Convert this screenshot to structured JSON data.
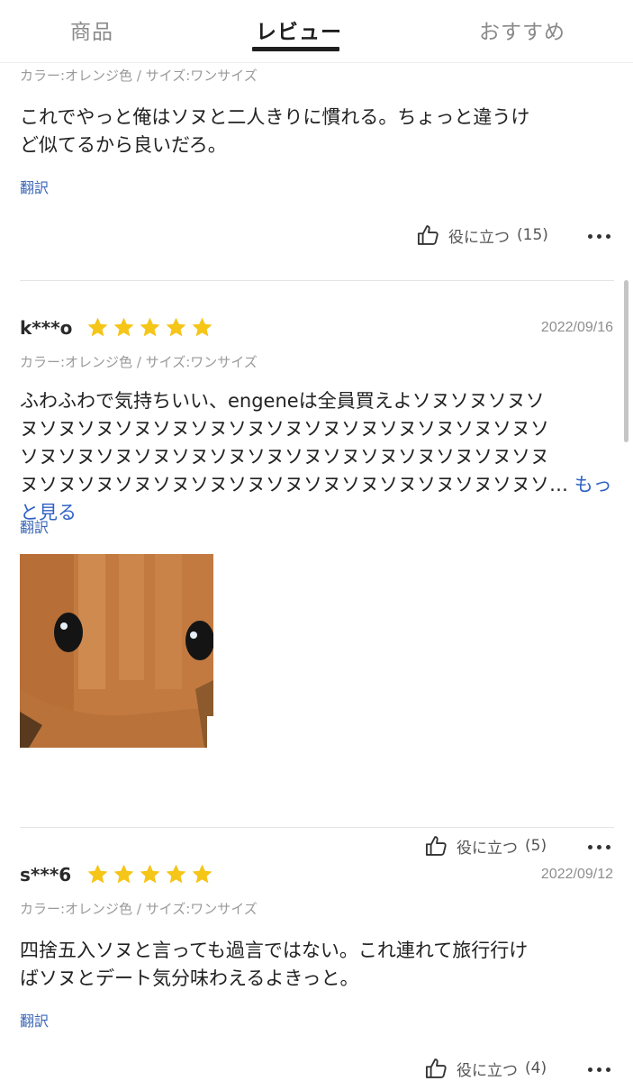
{
  "tabs": [
    {
      "label": "商品"
    },
    {
      "label": "レビュー"
    },
    {
      "label": "おすすめ"
    }
  ],
  "reviews": [
    {
      "variant": "カラー:オレンジ色 / サイズ:ワンサイズ",
      "text_lines": [
        "これでやっと俺はソヌと二人きりに慣れる。ちょっと違うけ",
        "ど似てるから良いだろ。"
      ],
      "translate": "翻訳",
      "helpful_label": "役に立つ",
      "helpful_count": "(15)"
    },
    {
      "user": "k***o",
      "rating": 5,
      "date": "2022/09/16",
      "variant": "カラー:オレンジ色 / サイズ:ワンサイズ",
      "text_lines": [
        "ふわふわで気持ちいい、engeneは全員買えよソヌソヌソヌソ",
        "ヌソヌソヌソヌソヌソヌソヌソヌソヌソヌソヌソヌソヌソヌソ",
        "ソヌソヌソヌソヌソヌソヌソヌソヌソヌソヌソヌソヌソヌソヌ",
        "ヌソヌソヌソヌソヌソヌソヌソヌソヌソヌソヌソヌソヌソヌソ…"
      ],
      "more": "もっと見る",
      "translate": "翻訳",
      "helpful_label": "役に立つ",
      "helpful_count": "(5)"
    },
    {
      "user": "s***6",
      "rating": 5,
      "date": "2022/09/12",
      "variant": "カラー:オレンジ色 / サイズ:ワンサイズ",
      "text_lines": [
        "四捨五入ソヌと言っても過言ではない。これ連れて旅行行け",
        "ばソヌとデート気分味わえるよきっと。"
      ],
      "translate": "翻訳",
      "helpful_label": "役に立つ",
      "helpful_count": "(4)"
    }
  ],
  "colors": {
    "star": "#f5c518",
    "link": "#2f62c6",
    "active_tab": "#1f1f1f"
  },
  "icons": [
    "thumbs-up-icon",
    "star-icon",
    "more-dots-icon"
  ]
}
